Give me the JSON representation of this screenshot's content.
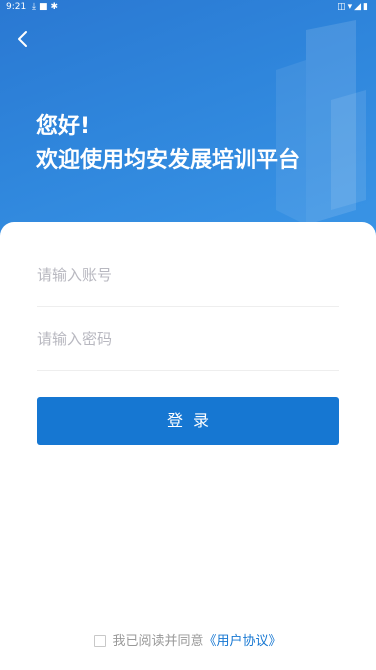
{
  "status_bar": {
    "time": "9:21",
    "left_icons": [
      "download-icon",
      "square-icon",
      "bug-icon"
    ],
    "right_icons": [
      "vibrate-icon",
      "wifi-icon",
      "signal-icon",
      "battery-icon"
    ]
  },
  "header": {
    "greeting_line1": "您好!",
    "greeting_line2": "欢迎使用均安发展培训平台"
  },
  "form": {
    "account_placeholder": "请输入账号",
    "password_placeholder": "请输入密码",
    "login_label": "登录"
  },
  "agreement": {
    "text": "我已阅读并同意",
    "link": "《用户协议》"
  },
  "colors": {
    "header_blue": "#2f86dc",
    "button_blue": "#1677d2",
    "link_blue": "#1677d2"
  }
}
